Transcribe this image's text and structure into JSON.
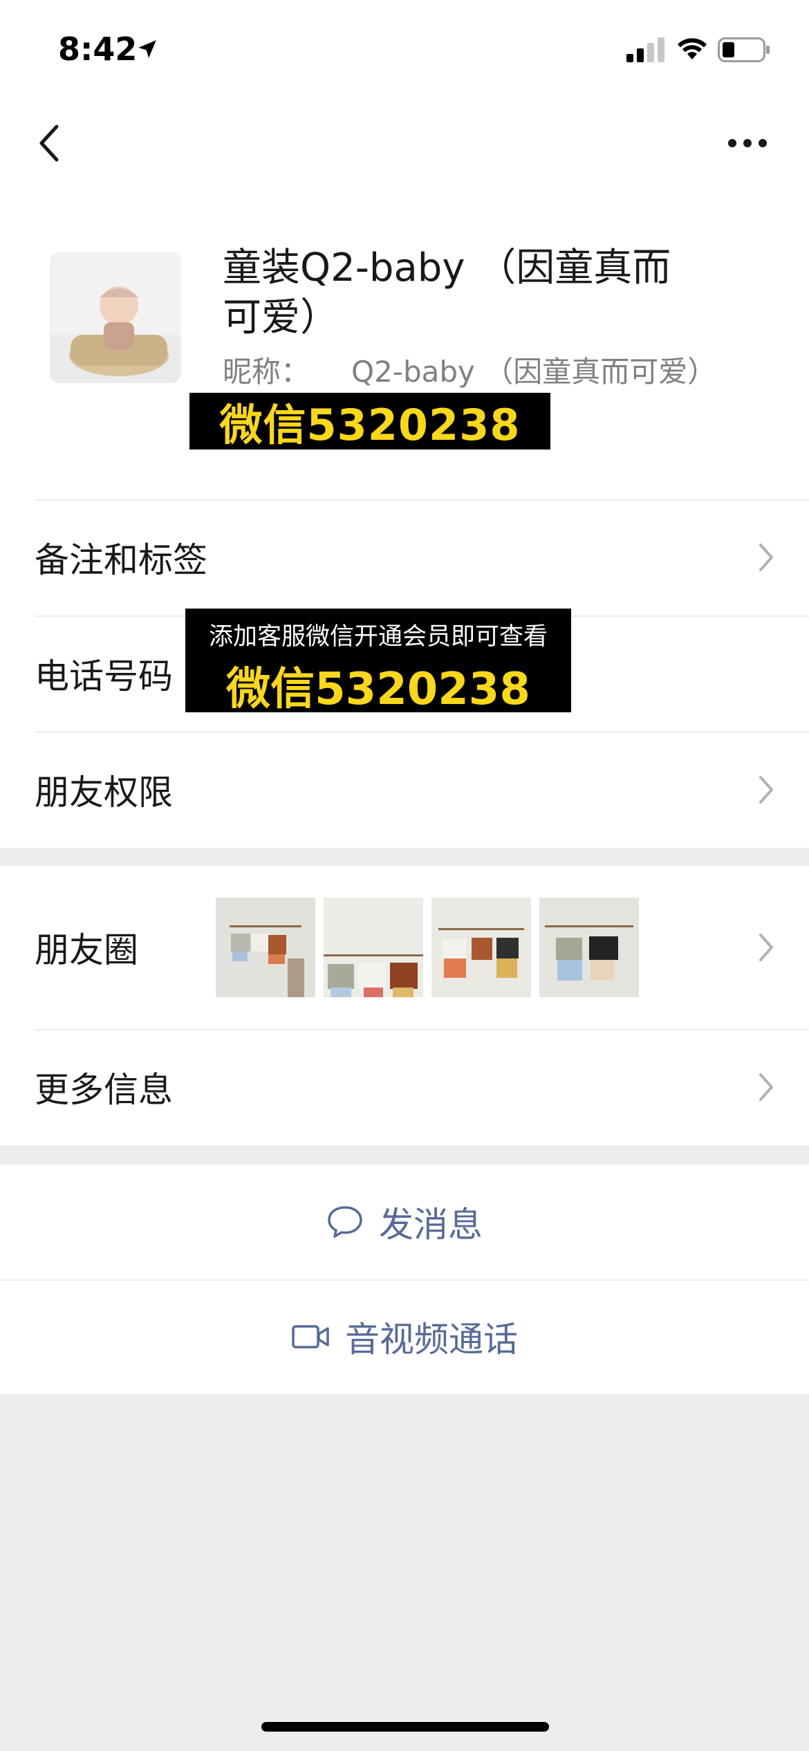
{
  "status_bar": {
    "time": "8:42"
  },
  "profile": {
    "display_name": "童装Q2-baby （因童真而可爱）",
    "nickname_label": "昵称：",
    "nickname_value": "Q2-baby （因童真而可爱）",
    "overlay_text": "微信5320238"
  },
  "rows": {
    "remarks": "备注和标签",
    "phone": "电话号码",
    "phone_overlay_notice": "添加客服微信开通会员即可查看",
    "phone_overlay_wechat": "微信5320238",
    "permissions": "朋友权限",
    "moments": "朋友圈",
    "more_info": "更多信息"
  },
  "actions": {
    "send_message": "发消息",
    "video_call": "音视频通话"
  },
  "colors": {
    "link": "#576b95",
    "overlay_text": "#f9d71c",
    "background": "#ededed"
  },
  "icons": [
    "location-arrow-icon",
    "signal-icon",
    "wifi-icon",
    "battery-icon",
    "back-chevron-icon",
    "more-dots-icon",
    "chevron-right-icon",
    "chat-bubble-icon",
    "video-camera-icon"
  ]
}
